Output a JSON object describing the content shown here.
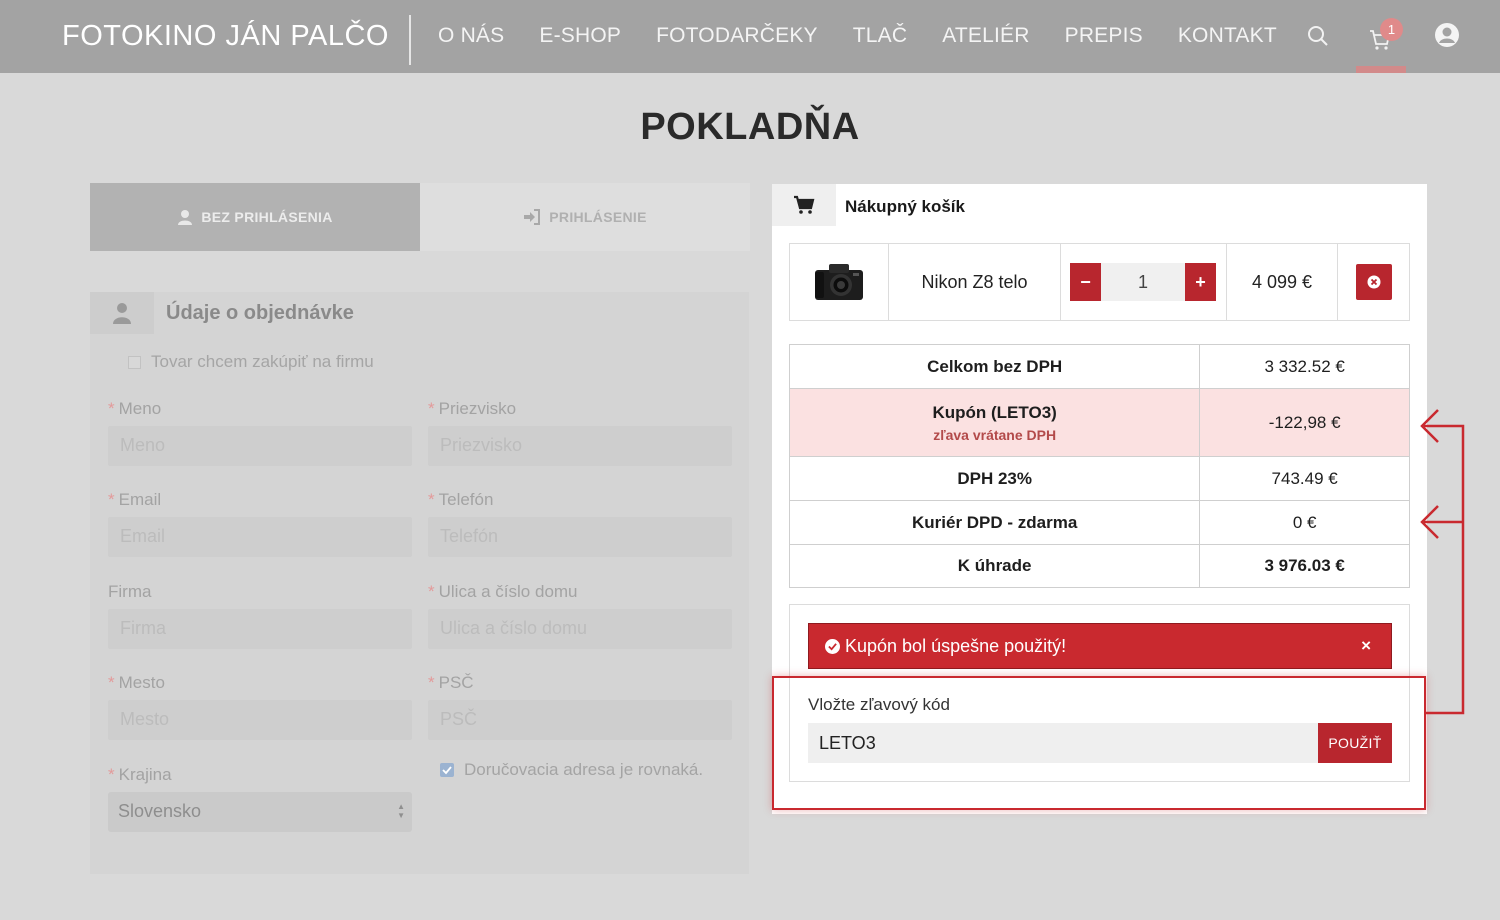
{
  "header": {
    "brand": "FOTOKINO JÁN PALČO",
    "nav": [
      "O NÁS",
      "E-SHOP",
      "FOTODARČEKY",
      "TLAČ",
      "ATELIÉR",
      "PREPIS",
      "KONTAKT"
    ],
    "cart_count": "1",
    "icons": [
      "search-icon",
      "cart-icon",
      "user-account-icon"
    ]
  },
  "page_title": "POKLADŇA",
  "tabs": {
    "guest": "BEZ PRIHLÁSENIA",
    "login": "PRIHLÁSENIE"
  },
  "order_form": {
    "title": "Údaje o objednávke",
    "company_checkbox": "Tovar chcem zakúpiť na firmu",
    "required_mark": "*",
    "fields": {
      "first_name": {
        "label": "Meno",
        "placeholder": "Meno"
      },
      "last_name": {
        "label": "Priezvisko",
        "placeholder": "Priezvisko"
      },
      "email": {
        "label": "Email",
        "placeholder": "Email"
      },
      "phone": {
        "label": "Telefón",
        "placeholder": "Telefón"
      },
      "company": {
        "label": "Firma",
        "placeholder": "Firma"
      },
      "street": {
        "label": "Ulica a číslo domu",
        "placeholder": "Ulica a číslo domu"
      },
      "city": {
        "label": "Mesto",
        "placeholder": "Mesto"
      },
      "zip": {
        "label": "PSČ",
        "placeholder": "PSČ"
      },
      "country": {
        "label": "Krajina",
        "value": "Slovensko"
      }
    },
    "same_address": "Doručovacia adresa je rovnaká."
  },
  "cart": {
    "title": "Nákupný košík",
    "item": {
      "name": "Nikon Z8 telo",
      "qty": "1",
      "minus": "−",
      "plus": "+",
      "price": "4 099 €"
    },
    "totals": {
      "net_label": "Celkom bez DPH",
      "net_value": "3 332.52 €",
      "coupon_label": "Kupón (LETO3)",
      "coupon_sub": "zľava vrátane DPH",
      "coupon_value": "-122,98 €",
      "vat_label": "DPH 23%",
      "vat_value": "743.49 €",
      "shipping_label": "Kuriér DPD - zdarma",
      "shipping_value": "0 €",
      "total_label": "K úhrade",
      "total_value": "3 976.03 €"
    },
    "coupon": {
      "alert": "Kupón bol úspešne použitý!",
      "alert_close": "×",
      "label": "Vložte zľavový kód",
      "value": "LETO3",
      "button": "POUŽIŤ"
    }
  },
  "colors": {
    "accent": "#b8262e",
    "header_bg": "#a3a3a3",
    "page_bg": "#d9d9d9",
    "coupon_row": "#fbe1e1"
  }
}
